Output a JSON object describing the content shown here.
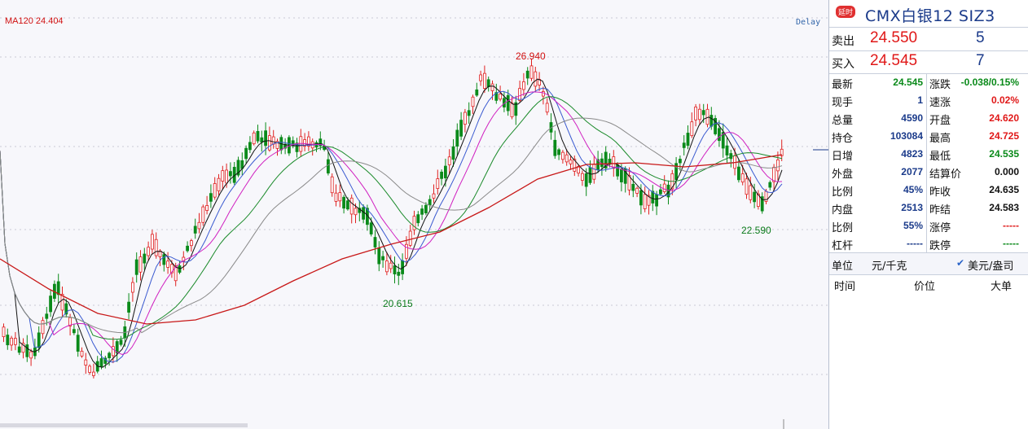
{
  "chart": {
    "ma_label": "MA120 24.404",
    "delay_label": "Delay",
    "high_label": "26.940",
    "low1_label": "20.615",
    "low2_label": "22.590",
    "colors": {
      "up": "#e02020",
      "down": "#0a8a1a",
      "ma120": "#c81818",
      "ma_a": "#111111",
      "ma_b": "#3a5ad0",
      "ma_c": "#d020c0",
      "ma_d": "#1a8a2a",
      "ma_e": "#8a8a8a",
      "grid": "#c8c8d4"
    }
  },
  "panel": {
    "badge": "延时",
    "title": "CMX白银12  SIZ3",
    "sell_label": "卖出",
    "sell_price": "24.550",
    "sell_vol": "5",
    "buy_label": "买入",
    "buy_price": "24.545",
    "buy_vol": "7",
    "stats_left": [
      {
        "label": "最新",
        "value": "24.545",
        "color": "#0a8a1a"
      },
      {
        "label": "现手",
        "value": "1",
        "color": "#1a3a8a"
      },
      {
        "label": "总量",
        "value": "4590",
        "color": "#1a3a8a"
      },
      {
        "label": "持仓",
        "value": "103084",
        "color": "#1a3a8a"
      },
      {
        "label": "日增",
        "value": "4823",
        "color": "#1a3a8a"
      },
      {
        "label": "外盘",
        "value": "2077",
        "color": "#1a3a8a"
      },
      {
        "label": "比例",
        "value": "45%",
        "color": "#1a3a8a"
      },
      {
        "label": "内盘",
        "value": "2513",
        "color": "#1a3a8a"
      },
      {
        "label": "比例",
        "value": "55%",
        "color": "#1a3a8a"
      },
      {
        "label": "杠杆",
        "value": "-----",
        "color": "#1a3a8a"
      }
    ],
    "stats_right": [
      {
        "label": "涨跌",
        "value": "-0.038/0.15%",
        "color": "#0a8a1a"
      },
      {
        "label": "速涨",
        "value": "0.02%",
        "color": "#e01818"
      },
      {
        "label": "开盘",
        "value": "24.620",
        "color": "#e01818"
      },
      {
        "label": "最高",
        "value": "24.725",
        "color": "#e01818"
      },
      {
        "label": "最低",
        "value": "24.535",
        "color": "#0a8a1a"
      },
      {
        "label": "结算价",
        "value": "0.000",
        "color": "#111111"
      },
      {
        "label": "昨收",
        "value": "24.635",
        "color": "#111111"
      },
      {
        "label": "昨结",
        "value": "24.583",
        "color": "#111111"
      },
      {
        "label": "涨停",
        "value": "-----",
        "color": "#e01818"
      },
      {
        "label": "跌停",
        "value": "-----",
        "color": "#0a8a1a"
      }
    ],
    "unit_label": "单位",
    "unit_opt1": "元/千克",
    "unit_opt2": "美元/盎司",
    "col_time": "时间",
    "col_price": "价位",
    "col_big": "大单"
  }
}
